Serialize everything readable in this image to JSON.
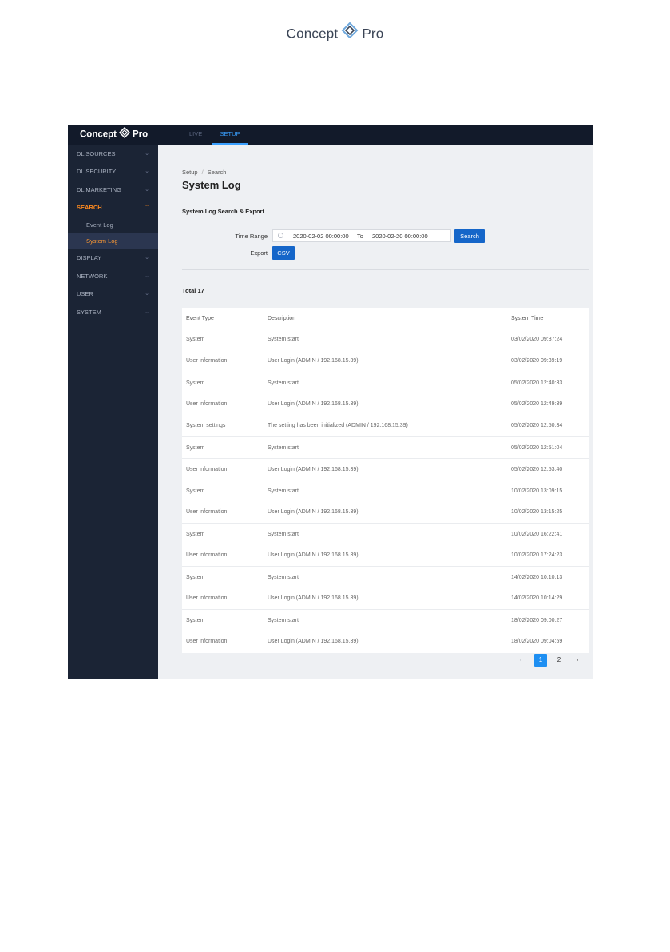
{
  "page_logo": {
    "word1": "Concept",
    "word2": "Pro"
  },
  "app": {
    "brand": {
      "word1": "Concept",
      "word2": "Pro"
    },
    "top_nav": [
      {
        "label": "LIVE"
      },
      {
        "label": "SETUP"
      }
    ],
    "sidebar": {
      "items": [
        {
          "label": "DL SOURCES"
        },
        {
          "label": "DL SECURITY"
        },
        {
          "label": "DL MARKETING"
        },
        {
          "label": "SEARCH"
        },
        {
          "label": "DISPLAY"
        },
        {
          "label": "NETWORK"
        },
        {
          "label": "USER"
        },
        {
          "label": "SYSTEM"
        }
      ],
      "search_sub": [
        {
          "label": "Event Log"
        },
        {
          "label": "System Log"
        }
      ]
    },
    "breadcrumb": {
      "root": "Setup",
      "current": "Search"
    },
    "page_title": "System Log",
    "section_title": "System Log Search & Export",
    "form": {
      "time_range_label": "Time Range",
      "start": "2020-02-02 00:00:00",
      "to_label": "To",
      "end": "2020-02-20 00:00:00",
      "search_label": "Search",
      "export_label": "Export",
      "csv_label": "CSV"
    },
    "total": "Total 17",
    "table": {
      "headers": {
        "event_type": "Event Type",
        "description": "Description",
        "system_time": "System Time"
      },
      "rows": [
        {
          "event_type": "System",
          "description": "System start",
          "system_time": "03/02/2020 09:37:24"
        },
        {
          "event_type": "User information",
          "description": "User Login (ADMIN / 192.168.15.39)",
          "system_time": "03/02/2020 09:39:19"
        },
        {
          "event_type": "System",
          "description": "System start",
          "system_time": "05/02/2020 12:40:33"
        },
        {
          "event_type": "User information",
          "description": "User Login (ADMIN / 192.168.15.39)",
          "system_time": "05/02/2020 12:49:39"
        },
        {
          "event_type": "System settings",
          "description": "The setting has been initialized (ADMIN / 192.168.15.39)",
          "system_time": "05/02/2020 12:50:34"
        },
        {
          "event_type": "System",
          "description": "System start",
          "system_time": "05/02/2020 12:51:04"
        },
        {
          "event_type": "User information",
          "description": "User Login (ADMIN / 192.168.15.39)",
          "system_time": "05/02/2020 12:53:40"
        },
        {
          "event_type": "System",
          "description": "System start",
          "system_time": "10/02/2020 13:09:15"
        },
        {
          "event_type": "User information",
          "description": "User Login (ADMIN / 192.168.15.39)",
          "system_time": "10/02/2020 13:15:25"
        },
        {
          "event_type": "System",
          "description": "System start",
          "system_time": "10/02/2020 16:22:41"
        },
        {
          "event_type": "User information",
          "description": "User Login (ADMIN / 192.168.15.39)",
          "system_time": "10/02/2020 17:24:23"
        },
        {
          "event_type": "System",
          "description": "System start",
          "system_time": "14/02/2020 10:10:13"
        },
        {
          "event_type": "User information",
          "description": "User Login (ADMIN / 192.168.15.39)",
          "system_time": "14/02/2020 10:14:29"
        },
        {
          "event_type": "System",
          "description": "System start",
          "system_time": "18/02/2020 09:00:27"
        },
        {
          "event_type": "User information",
          "description": "User Login (ADMIN / 192.168.15.39)",
          "system_time": "18/02/2020 09:04:59"
        }
      ]
    },
    "pagination": {
      "pages": [
        "1",
        "2"
      ],
      "prev": "‹",
      "next": "›"
    }
  }
}
